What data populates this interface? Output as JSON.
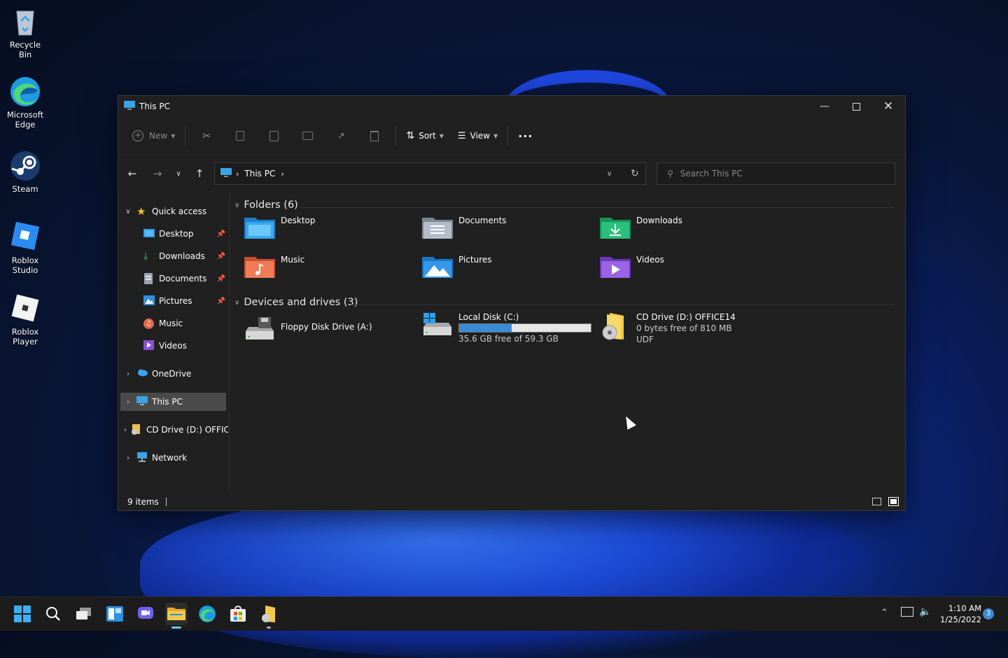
{
  "desktop": {
    "icons": [
      {
        "label": "Recycle Bin",
        "icon": "recycle-bin-icon"
      },
      {
        "label": "Microsoft Edge",
        "icon": "edge-icon"
      },
      {
        "label": "Steam",
        "icon": "steam-icon"
      },
      {
        "label": "Roblox Studio",
        "icon": "roblox-studio-icon"
      },
      {
        "label": "Roblox Player",
        "icon": "roblox-player-icon"
      }
    ]
  },
  "window": {
    "title": "This PC",
    "toolbar": {
      "new_label": "New",
      "sort_label": "Sort",
      "view_label": "View",
      "more_label": "···"
    },
    "address": {
      "location": "This PC",
      "search_placeholder": "Search This PC"
    },
    "sidebar": {
      "quick_access": "Quick access",
      "items": [
        {
          "label": "Desktop",
          "pinned": true
        },
        {
          "label": "Downloads",
          "pinned": true
        },
        {
          "label": "Documents",
          "pinned": true
        },
        {
          "label": "Pictures",
          "pinned": true
        },
        {
          "label": "Music",
          "pinned": false
        },
        {
          "label": "Videos",
          "pinned": false
        }
      ],
      "onedrive": "OneDrive",
      "this_pc": "This PC",
      "cd_drive": "CD Drive (D:) OFFICI",
      "network": "Network"
    },
    "folders": {
      "header": "Folders (6)",
      "items": [
        {
          "label": "Desktop"
        },
        {
          "label": "Documents"
        },
        {
          "label": "Downloads"
        },
        {
          "label": "Music"
        },
        {
          "label": "Pictures"
        },
        {
          "label": "Videos"
        }
      ]
    },
    "drives": {
      "header": "Devices and drives (3)",
      "floppy": {
        "label": "Floppy Disk Drive (A:)"
      },
      "local": {
        "label": "Local Disk (C:)",
        "free": "35.6 GB free of 59.3 GB",
        "used_fraction": 0.4
      },
      "cd": {
        "label": "CD Drive (D:) OFFICE14",
        "free": "0 bytes free of 810 MB",
        "fs": "UDF"
      }
    },
    "status": {
      "items": "9 items"
    }
  },
  "taskbar": {
    "time": "1:10 AM",
    "date": "1/25/2022",
    "notifications": "3"
  },
  "colors": {
    "accent": "#3b8bd6",
    "folder": "#2fa0e8",
    "window_bg": "#202020"
  }
}
